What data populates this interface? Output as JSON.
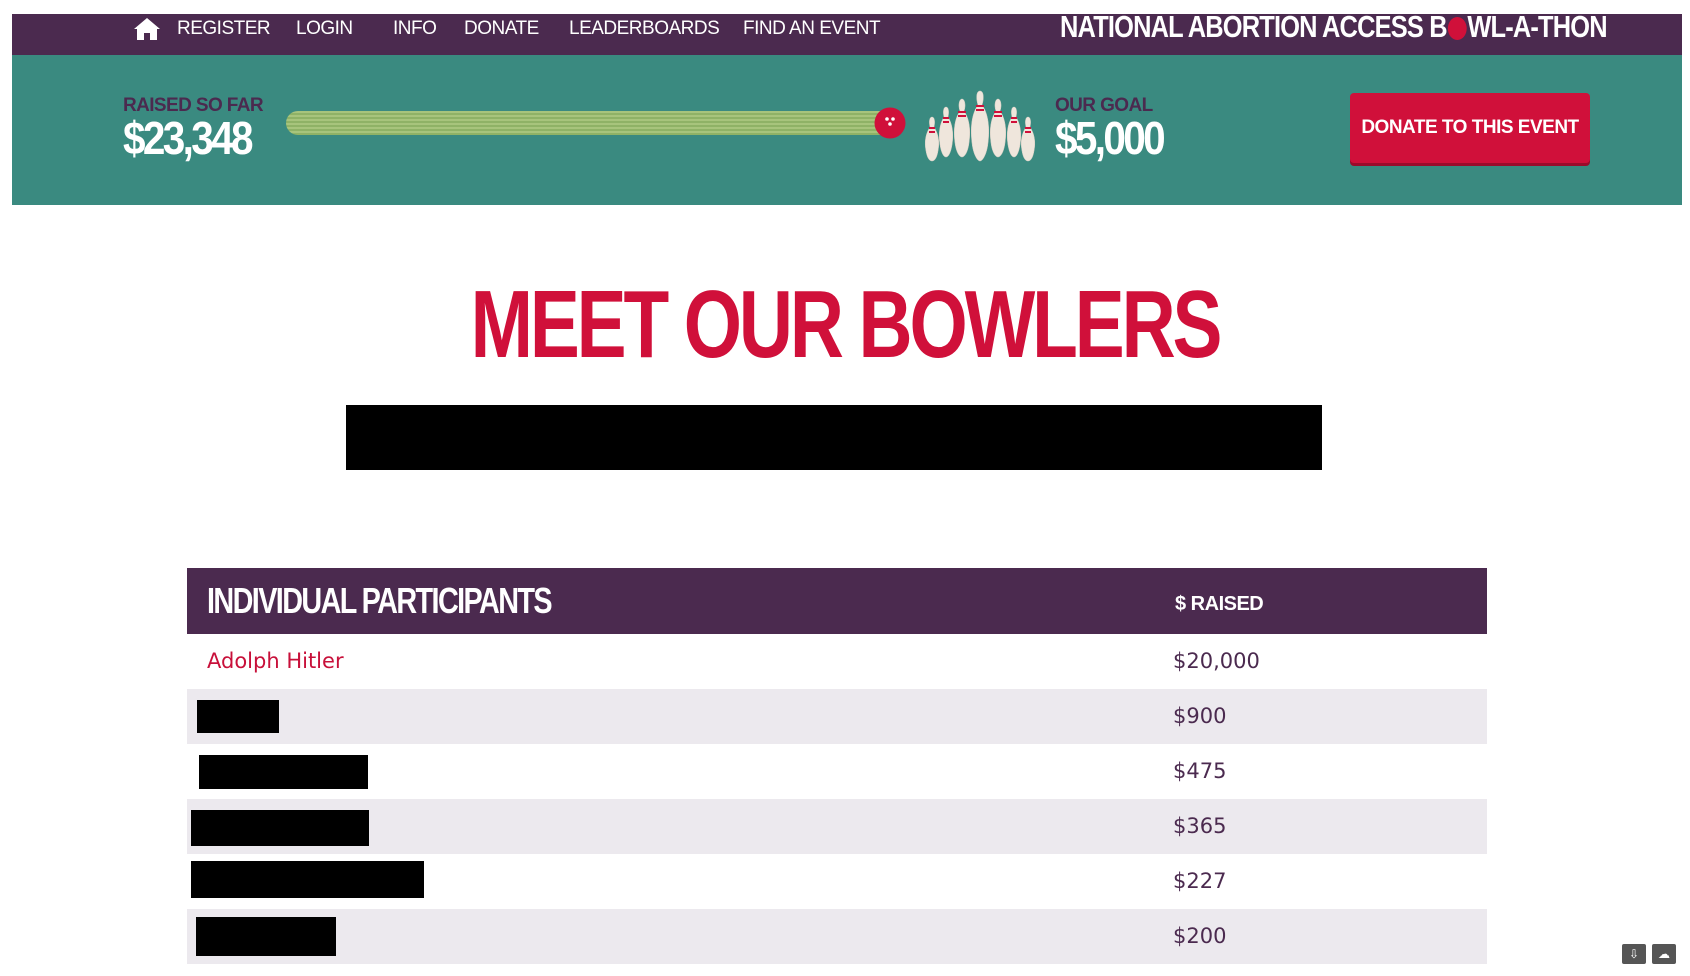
{
  "nav": {
    "items": [
      "REGISTER",
      "LOGIN",
      "INFO",
      "DONATE",
      "LEADERBOARDS",
      "FIND AN EVENT"
    ],
    "site_title_before": "NATIONAL ABORTION ACCESS B",
    "site_title_after": "WL-A-THON"
  },
  "progress": {
    "raised_label": "RAISED SO FAR",
    "raised_amount": "$23,348",
    "goal_label": "OUR GOAL",
    "goal_amount": "$5,000",
    "fraction": 1.0,
    "donate_label": "DONATE TO THIS EVENT"
  },
  "heading": "MEET OUR BOWLERS",
  "table": {
    "name_header": "INDIVIDUAL PARTICIPANTS",
    "amount_header": "$ RAISED",
    "rows": [
      {
        "name": "Adolph Hitler",
        "amount": "$20,000"
      },
      {
        "name": "",
        "amount": "$900"
      },
      {
        "name": "",
        "amount": "$475"
      },
      {
        "name": "",
        "amount": "$365"
      },
      {
        "name": "",
        "amount": "$227"
      },
      {
        "name": "",
        "amount": "$200"
      }
    ]
  },
  "colors": {
    "nav_bg": "#4b2a4f",
    "band_bg": "#3a8a80",
    "accent_red": "#d0103a",
    "row_alt": "#ece9ee"
  },
  "icons": [
    "home-icon",
    "bowling-ball-icon",
    "bowling-pins-icon",
    "download-icon",
    "cloud-icon"
  ]
}
